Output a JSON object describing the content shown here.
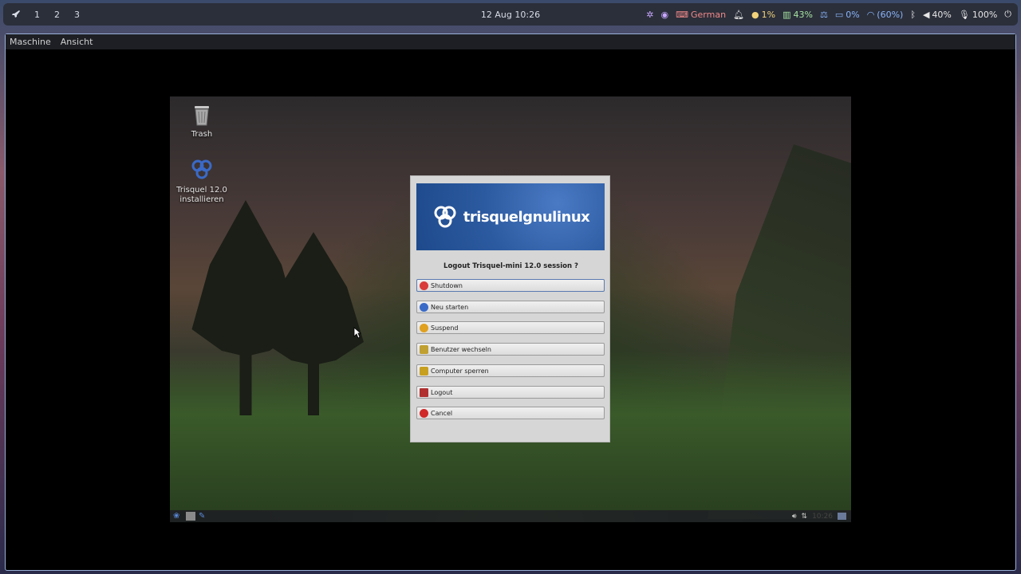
{
  "topbar": {
    "workspaces": [
      "1",
      "2",
      "3"
    ],
    "datetime": "12 Aug 10:26",
    "keyboard_layout": "German",
    "cpu": "1%",
    "battery": "43%",
    "brightness": "0%",
    "wifi": "(60%)",
    "volume": "40%",
    "mic": "100%"
  },
  "vm": {
    "menu": [
      "Maschine",
      "Ansicht"
    ],
    "desktop_icons": [
      {
        "label": "Trash"
      },
      {
        "label": "Trisquel 12.0 installieren"
      }
    ],
    "panel_clock": "10:26"
  },
  "dialog": {
    "brand": "trisquelgnulinux",
    "question": "Logout Trisquel-mini 12.0 session ?",
    "buttons": [
      {
        "label": "Shutdown",
        "icon": "power-icon",
        "color": "#d93a3a"
      },
      {
        "label": "Neu starten",
        "icon": "restart-icon",
        "color": "#3a6ac8"
      },
      {
        "label": "Suspend",
        "icon": "suspend-icon",
        "color": "#e0a020"
      },
      {
        "label": "Benutzer wechseln",
        "icon": "switch-user-icon",
        "color": "#c0a030"
      },
      {
        "label": "Computer sperren",
        "icon": "lock-icon",
        "color": "#c8a020"
      },
      {
        "label": "Logout",
        "icon": "logout-icon",
        "color": "#b03030"
      },
      {
        "label": "Cancel",
        "icon": "cancel-icon",
        "color": "#d02828"
      }
    ]
  }
}
